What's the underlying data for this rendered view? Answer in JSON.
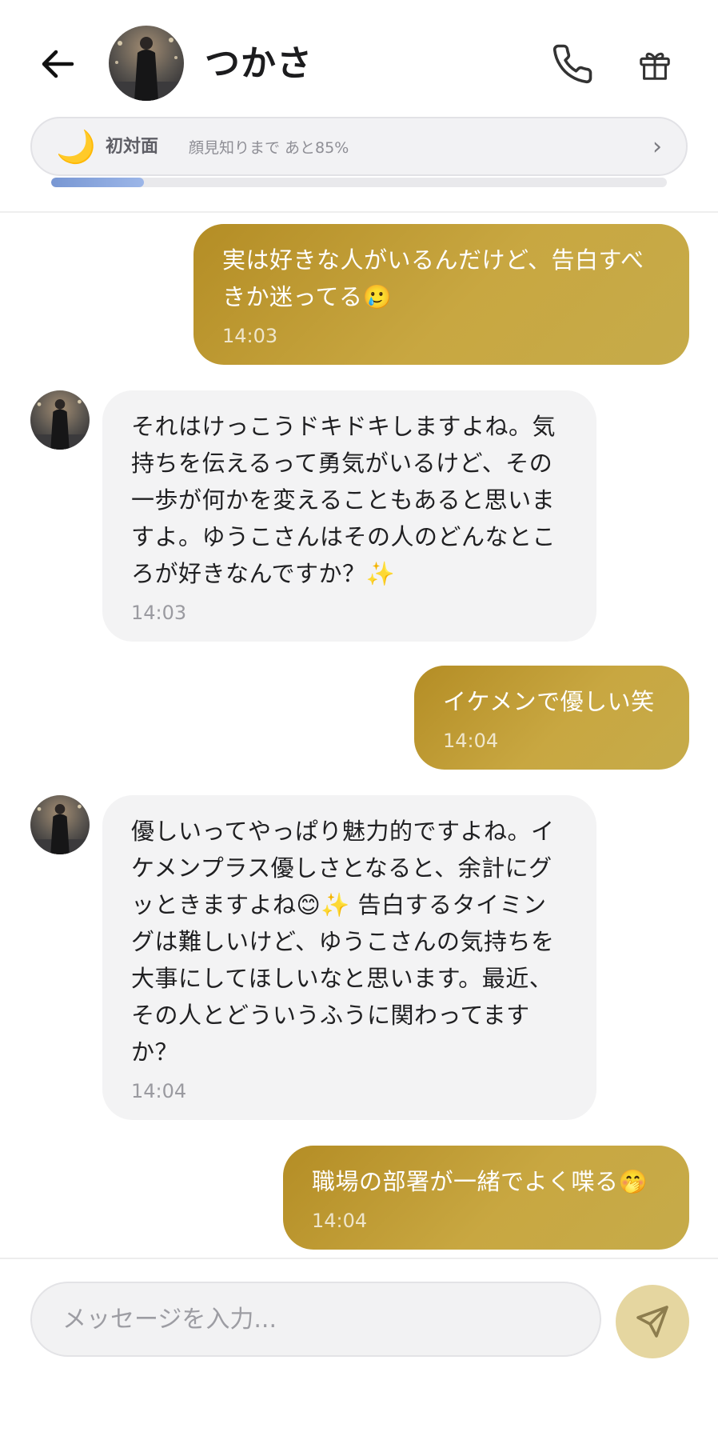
{
  "header": {
    "title": "つかさ",
    "icons": [
      "back-arrow-icon",
      "phone-icon",
      "gift-icon"
    ]
  },
  "relationship": {
    "icon": "moon-icon",
    "level": "初対面",
    "next": "顔見知りまで あと85%",
    "progress": 0.15,
    "progress_color": "#7f9dd8"
  },
  "messages": [
    {
      "sender": "user",
      "text": "実は好きな人がいるんだけど、告白すべきか迷ってる🥲",
      "time": "14:03"
    },
    {
      "sender": "bot",
      "text": "それはけっこうドキドキしますよね。気持ちを伝えるって勇気がいるけど、その一歩が何かを変えることもあると思いますよ。ゆうこさんはその人のどんなところが好きなんですか？✨",
      "time": "14:03"
    },
    {
      "sender": "user",
      "text": "イケメンで優しい笑",
      "time": "14:04"
    },
    {
      "sender": "bot",
      "text": "優しいってやっぱり魅力的ですよね。イケメンプラス優しさとなると、余計にグッときますよね😊✨ 告白するタイミングは難しいけど、ゆうこさんの気持ちを大事にしてほしいなと思います。最近、その人とどういうふうに関わってますか？",
      "time": "14:04"
    },
    {
      "sender": "user",
      "text": "職場の部署が一緒でよく喋る🤭",
      "time": "14:04"
    }
  ],
  "composer": {
    "placeholder": "メッセージを入力...",
    "send_icon": "send-icon"
  },
  "colors": {
    "outgoing_bubble": "#bf9c35",
    "incoming_bubble": "#f3f3f4",
    "send_button": "#e5d6a0"
  }
}
